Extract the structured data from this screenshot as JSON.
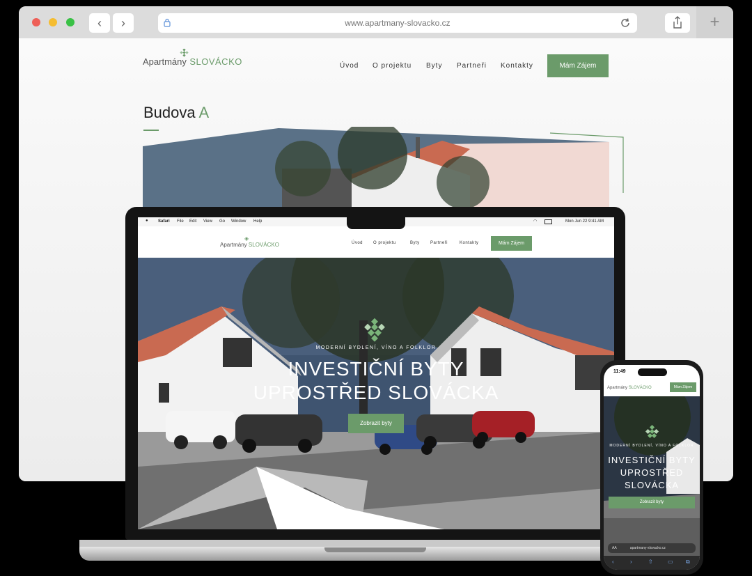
{
  "browser": {
    "url": "www.apartmany-slovacko.cz",
    "back_icon": "‹",
    "forward_icon": "›",
    "new_tab_icon": "+"
  },
  "site": {
    "logo_main": "Apartmány",
    "logo_accent": "SLOVÁCKO",
    "nav": [
      "Úvod",
      "O projektu",
      "Byty",
      "Partneři",
      "Kontakty"
    ],
    "cta": "Mám Zájem",
    "section_title_main": "Budova",
    "section_title_accent": "A"
  },
  "laptop": {
    "menubar": [
      "Safari",
      "File",
      "Edit",
      "View",
      "Go",
      "Window",
      "Help"
    ],
    "status": "Mon Jun 22  9:41 AM",
    "hero_kicker": "MODERNÍ BYDLENÍ, VÍNO A FOLKLOR",
    "hero_title_line1": "INVESTIČNÍ BYTY",
    "hero_title_line2": "UPROSTŘED SLOVÁCKA",
    "hero_button": "Zobrazit byty"
  },
  "phone": {
    "time": "11:49",
    "cta": "Mám Zájem",
    "hero_kicker": "MODERNÍ BYDLENÍ, VÍNO A FOLKLOR",
    "hero_title_line1": "INVESTIČNÍ BYTY",
    "hero_title_line2": "UPROSTŘED",
    "hero_title_line3": "SLOVÁCKA",
    "hero_button": "Zobrazit byty",
    "address_text_size": "AA",
    "address": "apartmany-slovacko.cz"
  },
  "colors": {
    "accent": "#6b9b6a",
    "sky": "#3e5470",
    "roof": "#c9684f"
  }
}
